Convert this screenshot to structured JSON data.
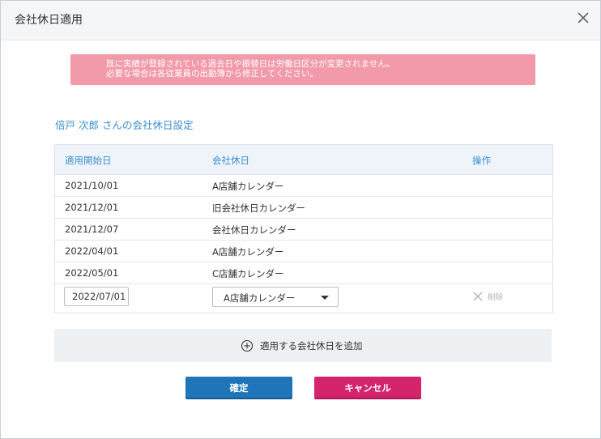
{
  "dialog": {
    "title": "会社休日適用",
    "close_icon": "close-icon"
  },
  "alert": {
    "line1": "既に実績が登録されている過去日や振替日は労働日区分が変更されません。",
    "line2": "必要な場合は各従業員の出勤簿から修正してください。",
    "color": "#f29aa9"
  },
  "section": {
    "title": "倍戸 次郎 さんの会社休日設定"
  },
  "table": {
    "headers": [
      "適用開始日",
      "会社休日",
      "操作"
    ],
    "rows": [
      {
        "start": "2021/10/01",
        "calendar": "A店舗カレンダー"
      },
      {
        "start": "2021/12/01",
        "calendar": "旧会社休日カレンダー"
      },
      {
        "start": "2021/12/07",
        "calendar": "会社休日カレンダー"
      },
      {
        "start": "2022/04/01",
        "calendar": "A店舗カレンダー"
      },
      {
        "start": "2022/05/01",
        "calendar": "C店舗カレンダー"
      }
    ],
    "edit_row": {
      "date_value": "2022/07/01",
      "calendar_selected": "A店舗カレンダー",
      "delete_label": "削除"
    }
  },
  "add": {
    "label": "適用する会社休日を追加",
    "icon": "plus-circle-icon"
  },
  "buttons": {
    "confirm": "確定",
    "cancel": "キャンセル",
    "confirm_color": "#1f75b9",
    "cancel_color": "#d4246c"
  },
  "colors": {
    "accent": "#3b8fd0"
  }
}
